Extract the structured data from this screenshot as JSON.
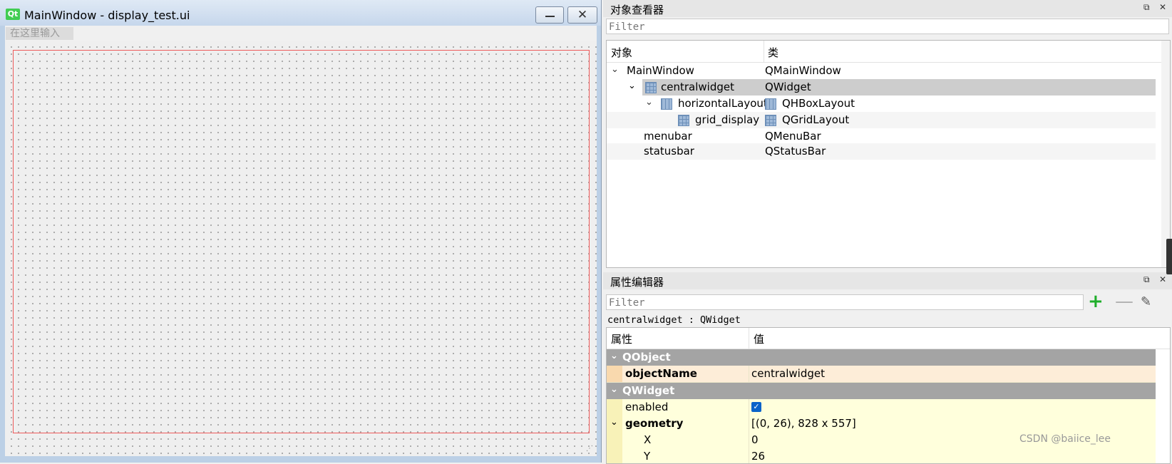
{
  "main_window": {
    "title": "MainWindow - display_test.ui",
    "logo": "Qt",
    "minimize": "—",
    "close": "✕",
    "menu_placeholder": "在这里输入"
  },
  "object_inspector": {
    "title": "对象查看器",
    "filter_placeholder": "Filter",
    "columns": [
      "对象",
      "类"
    ],
    "rows": [
      {
        "name": "MainWindow",
        "class": "QMainWindow"
      },
      {
        "name": "centralwidget",
        "class": "QWidget"
      },
      {
        "name": "horizontalLayout",
        "class": "QHBoxLayout"
      },
      {
        "name": "grid_display",
        "class": "QGridLayout"
      },
      {
        "name": "menubar",
        "class": "QMenuBar"
      },
      {
        "name": "statusbar",
        "class": "QStatusBar"
      }
    ]
  },
  "property_editor": {
    "title": "属性编辑器",
    "filter_placeholder": "Filter",
    "context": "centralwidget : QWidget",
    "columns": [
      "属性",
      "值"
    ],
    "rows": [
      {
        "name": "QObject",
        "value": ""
      },
      {
        "name": "objectName",
        "value": "centralwidget"
      },
      {
        "name": "QWidget",
        "value": ""
      },
      {
        "name": "enabled",
        "value": "✓"
      },
      {
        "name": "geometry",
        "value": "[(0, 26), 828 x 557]"
      },
      {
        "name": "X",
        "value": "0"
      },
      {
        "name": "Y",
        "value": "26"
      }
    ]
  },
  "icons": {
    "float": "⧉",
    "close": "✕",
    "expand": "⌄",
    "plus": "+",
    "minus": "—",
    "wrench": "✎"
  },
  "watermark": "CSDN @baiice_lee"
}
